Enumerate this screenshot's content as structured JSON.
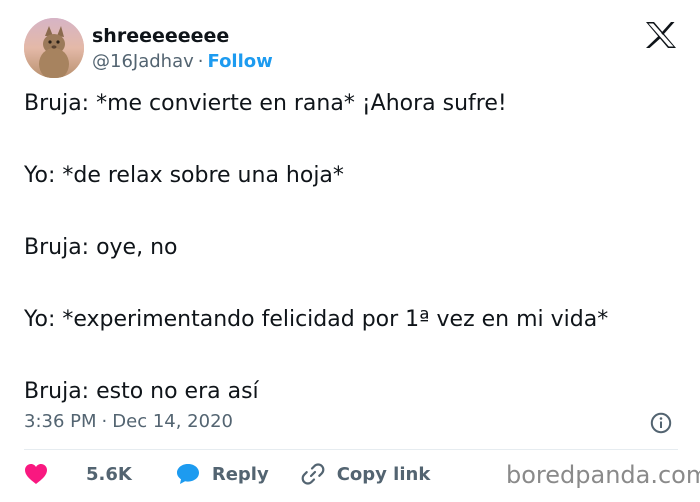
{
  "author": {
    "display_name": "shreeeeeeee",
    "handle": "@16Jadhav",
    "separator": "·",
    "follow_label": "Follow"
  },
  "tweet": {
    "lines": [
      "Bruja: *me convierte en rana* ¡Ahora sufre!",
      "Yo: *de relax sobre una hoja*",
      "Bruja: oye, no",
      "Yo: *experimentando felicidad por 1ª vez en mi vida*",
      "Bruja: esto no era así"
    ],
    "time": "3:36 PM",
    "separator": "·",
    "date": "Dec 14, 2020"
  },
  "actions": {
    "likes": "5.6K",
    "reply_label": "Reply",
    "copy_label": "Copy link"
  },
  "icons": {
    "logo": "x-logo-icon",
    "info": "info-icon",
    "like": "heart-icon",
    "reply": "speech-bubble-icon",
    "copy": "link-icon"
  },
  "colors": {
    "text": "#0f1419",
    "muted": "#536471",
    "accent": "#1d9bf0",
    "heart": "#f91880"
  },
  "watermark": "boredpanda.com"
}
